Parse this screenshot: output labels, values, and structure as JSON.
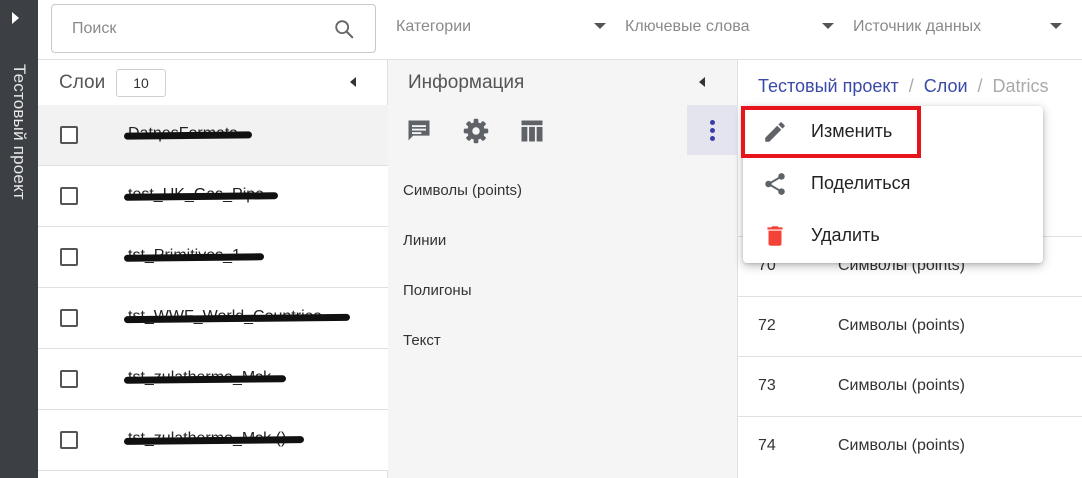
{
  "sidebar_strip": {
    "project_title": "Тестовый проект",
    "expand_icon": "chevron-right-icon"
  },
  "search": {
    "placeholder": "Поиск",
    "value": "",
    "icon": "search-icon"
  },
  "filters": [
    {
      "label": "Категории",
      "icon": "caret-down-icon"
    },
    {
      "label": "Ключевые слова",
      "icon": "caret-down-icon"
    },
    {
      "label": "Источник данных",
      "icon": "caret-down-icon"
    }
  ],
  "layers": {
    "title": "Слои",
    "count": "10",
    "collapse_icon": "chevron-left-icon",
    "items": [
      {
        "name": "DatηesFormats",
        "redacted": true,
        "selected": true
      },
      {
        "name": "test_UK_Gas_Pipe",
        "redacted": true,
        "selected": false
      },
      {
        "name": "tst_Primitives_1",
        "redacted": true,
        "selected": false
      },
      {
        "name": "tst_WWF_World_Countries",
        "redacted": true,
        "selected": false
      },
      {
        "name": "tst_zulathermo_Msk",
        "redacted": true,
        "selected": false
      },
      {
        "name": "tst_zulathermo_Msk ()",
        "redacted": true,
        "selected": false
      }
    ]
  },
  "info": {
    "title": "Информация",
    "collapse_icon": "chevron-left-icon",
    "tools": [
      "comment-icon",
      "gear-icon",
      "table-icon"
    ],
    "more_icon": "more-vertical-icon",
    "geometry_types": [
      "Символы (points)",
      "Линии",
      "Полигоны",
      "Текст"
    ]
  },
  "breadcrumb": {
    "project": "Тестовый проект",
    "layers": "Слои",
    "current": "Datrics",
    "separator": "/"
  },
  "table": {
    "rows": [
      {
        "id": "70",
        "type": "Символы (points)"
      },
      {
        "id": "72",
        "type": "Символы (points)"
      },
      {
        "id": "73",
        "type": "Символы (points)"
      },
      {
        "id": "74",
        "type": "Символы (points)"
      }
    ]
  },
  "context_menu": {
    "items": [
      {
        "label": "Изменить",
        "icon": "pencil-icon",
        "highlighted": true
      },
      {
        "label": "Поделиться",
        "icon": "share-icon",
        "highlighted": false
      },
      {
        "label": "Удалить",
        "icon": "trash-icon",
        "highlighted": false
      }
    ]
  },
  "colors": {
    "accent": "#3a4aa8",
    "highlight": "#e8141c",
    "danger": "#f44336",
    "strip": "#3c3f44"
  }
}
